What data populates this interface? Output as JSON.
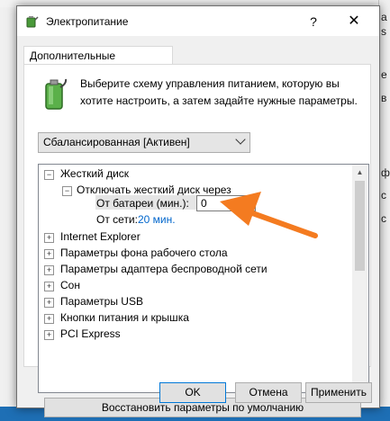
{
  "window": {
    "title": "Электропитание",
    "help": "?",
    "close": "✕"
  },
  "background": {
    "right_items": [
      "а",
      "s",
      "е",
      "в",
      "ф",
      "с",
      "с"
    ]
  },
  "tab": {
    "label": "Дополнительные параметры"
  },
  "description": "Выберите схему управления питанием, которую вы хотите настроить, а затем задайте нужные параметры.",
  "plan_select": {
    "value": "Сбалансированная [Активен]"
  },
  "tree": {
    "hdd": {
      "label": "Жесткий диск",
      "toggle": "−"
    },
    "hdd_off": {
      "label": "Отключать жесткий диск через",
      "toggle": "−"
    },
    "battery": {
      "label": "От батареи (мин.):",
      "value": "0"
    },
    "ac": {
      "label": "От сети:",
      "value": "20 мин."
    },
    "items": [
      "Internet Explorer",
      "Параметры фона рабочего стола",
      "Параметры адаптера беспроводной сети",
      "Сон",
      "Параметры USB",
      "Кнопки питания и крышка",
      "PCI Express"
    ],
    "expand": "+"
  },
  "restore_button": "Восстановить параметры по умолчанию",
  "buttons": {
    "ok": "OK",
    "cancel": "Отмена",
    "apply": "Применить"
  },
  "colors": {
    "arrow": "#f47b20",
    "link": "#0066cc"
  }
}
